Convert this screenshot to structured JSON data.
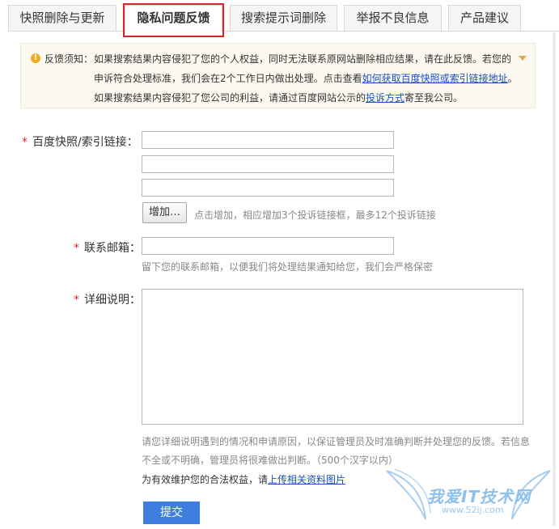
{
  "tabs": [
    {
      "label": "快照删除与更新",
      "active": false
    },
    {
      "label": "隐私问题反馈",
      "active": true
    },
    {
      "label": "搜索提示词删除",
      "active": false
    },
    {
      "label": "举报不良信息",
      "active": false
    },
    {
      "label": "产品建议",
      "active": false
    }
  ],
  "notice": {
    "icon": "warning-icon",
    "label": "反馈须知：",
    "line1": "如果搜索结果内容侵犯了您的个人权益，同时无法联系原网站删除相应结果，请在此反馈。若您的",
    "line2_pre": "申诉符合处理标准，我们会在2个工作日内做出处理。点击查看",
    "line2_link": "如何获取百度快照或索引链接地址",
    "line2_post": "。",
    "line3_pre": "如果搜索结果内容侵犯了您公司的利益，请通过百度网站公示的",
    "line3_link": "投诉方式",
    "line3_post": "寄至我公司。"
  },
  "form": {
    "required_mark": "*",
    "links_label": "百度快照/索引链接：",
    "add_button": "增加…",
    "add_hint": "点击增加，相应增加3个投诉链接框，最多12个投诉链接",
    "email_label": "联系邮箱：",
    "email_hint": "留下您的联系邮箱，以便我们将处理结果通知给您，我们会严格保密",
    "detail_label": "详细说明：",
    "detail_hint1": "请您详细说明遇到的情况和申请原因，以保证管理员及时准确判断并处理您的反馈。若信息",
    "detail_hint2": "不全或不明确，管理员将很难做出判断。（500个汉字以内）",
    "upload_pre": "为有效维护您的合法权益，请",
    "upload_link": "上传相关资料图片",
    "submit": "提交"
  },
  "watermark": {
    "text": "我爱IT技术网",
    "url": "www.52ij.com"
  },
  "colors": {
    "required": "#d62a2a",
    "link": "#1a4fbf",
    "submit_bg": "#3d7ee0",
    "highlight": "#e02222"
  }
}
